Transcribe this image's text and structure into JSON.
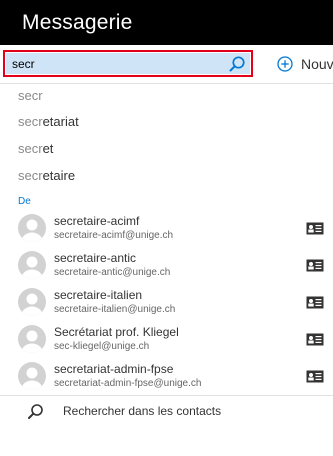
{
  "app": {
    "title": "Messagerie"
  },
  "search": {
    "value": "secr",
    "placeholder": ""
  },
  "toolbar": {
    "new_label": "Nouve"
  },
  "suggestions": [
    {
      "typed": "secr",
      "rest": ""
    },
    {
      "typed": "secr",
      "rest": "etariat"
    },
    {
      "typed": "secr",
      "rest": "et"
    },
    {
      "typed": "secr",
      "rest": "etaire"
    }
  ],
  "section": {
    "label": "De"
  },
  "contacts": [
    {
      "name": "secretaire-acimf",
      "email": "secretaire-acimf@unige.ch"
    },
    {
      "name": "secretaire-antic",
      "email": "secretaire-antic@unige.ch"
    },
    {
      "name": "secretaire-italien",
      "email": "secretaire-italien@unige.ch"
    },
    {
      "name": "Secrétariat prof. Kliegel",
      "email": "sec-kliegel@unige.ch"
    },
    {
      "name": "secretariat-admin-fpse",
      "email": "secretariat-admin-fpse@unige.ch"
    }
  ],
  "footer": {
    "search_contacts_label": "Rechercher dans les contacts"
  },
  "icons": {
    "search": "search-icon",
    "new": "plus-circle-icon",
    "avatar": "person-icon",
    "contact_card": "contact-card-icon"
  },
  "colors": {
    "topbar": "#000000",
    "search_highlight": "#cfe4f7",
    "search_border": "#e3001b",
    "accent": "#0078d4"
  }
}
